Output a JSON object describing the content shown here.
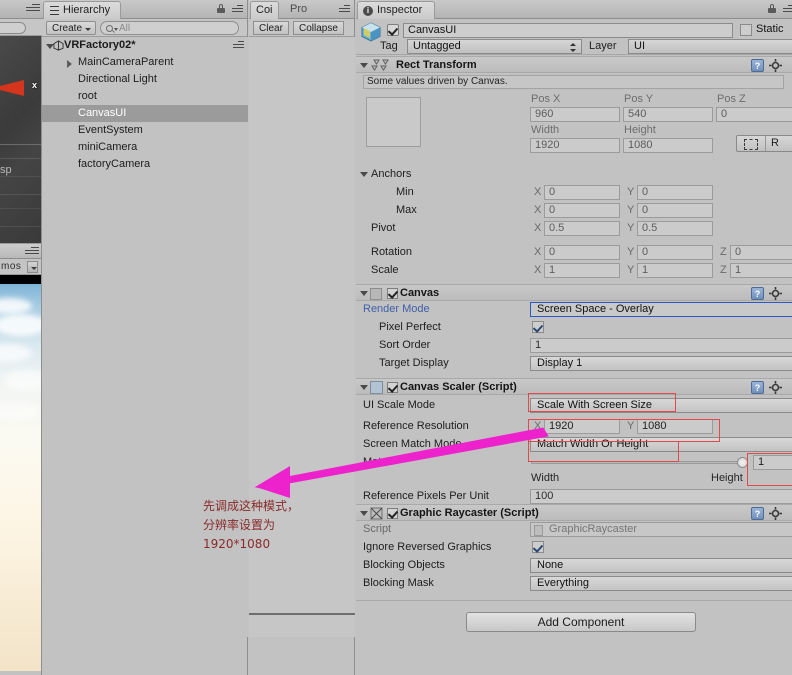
{
  "scene_view": {
    "gizmo_axis_label": "x",
    "partial_text": "sp",
    "gizmos_label": "mos"
  },
  "hierarchy": {
    "tab_label": "Hierarchy",
    "create_label": "Create",
    "search_placeholder": "All",
    "root": {
      "label": "VRFactory02*"
    },
    "items": [
      {
        "label": "MainCameraParent",
        "has_children": true,
        "selected": false
      },
      {
        "label": "Directional Light",
        "has_children": false,
        "selected": false
      },
      {
        "label": "root",
        "has_children": false,
        "selected": false
      },
      {
        "label": "CanvasUI",
        "has_children": false,
        "selected": true
      },
      {
        "label": "EventSystem",
        "has_children": false,
        "selected": false
      },
      {
        "label": "miniCamera",
        "has_children": false,
        "selected": false
      },
      {
        "label": "factoryCamera",
        "has_children": false,
        "selected": false
      }
    ]
  },
  "console": {
    "tab_active": "Coi",
    "tab_inactive": "Pro",
    "clear_label": "Clear",
    "collapse_label": "Collapse"
  },
  "inspector": {
    "tab_label": "Inspector",
    "object_name": "CanvasUI",
    "static_label": "Static",
    "tag_label": "Tag",
    "tag_value": "Untagged",
    "layer_label": "Layer",
    "layer_value": "UI",
    "add_component_label": "Add Component",
    "components": [
      {
        "title": "Rect Transform",
        "driven_note": "Some values driven by Canvas.",
        "pos_headers": [
          "Pos X",
          "Pos Y",
          "Pos Z"
        ],
        "pos_values": [
          "960",
          "540",
          "0"
        ],
        "size_headers": [
          "Width",
          "Height"
        ],
        "size_values": [
          "1920",
          "1080"
        ],
        "rect_tool_label": "R",
        "anchors_label": "Anchors",
        "min_label": "Min",
        "min_x": "0",
        "min_y": "0",
        "max_label": "Max",
        "max_x": "0",
        "max_y": "0",
        "pivot_label": "Pivot",
        "pivot_x": "0.5",
        "pivot_y": "0.5",
        "rotation_label": "Rotation",
        "rot_x": "0",
        "rot_y": "0",
        "rot_z": "0",
        "scale_label": "Scale",
        "scale_x": "1",
        "scale_y": "1",
        "scale_z": "1",
        "axis_x": "X",
        "axis_y": "Y",
        "axis_z": "Z"
      },
      {
        "title": "Canvas",
        "render_mode_label": "Render Mode",
        "render_mode_value": "Screen Space - Overlay",
        "pixel_perfect_label": "Pixel Perfect",
        "sort_order_label": "Sort Order",
        "sort_order_value": "1",
        "target_display_label": "Target Display",
        "target_display_value": "Display 1"
      },
      {
        "title": "Canvas Scaler (Script)",
        "ui_scale_mode_label": "UI Scale Mode",
        "ui_scale_mode_value": "Scale With Screen Size",
        "ref_res_label": "Reference Resolution",
        "ref_res_x": "1920",
        "ref_res_y": "1080",
        "screen_match_label": "Screen Match Mode",
        "screen_match_value": "Match Width Or Height",
        "match_label": "Match",
        "match_value": "1",
        "width_label": "Width",
        "height_label": "Height",
        "ref_ppu_label": "Reference Pixels Per Unit",
        "ref_ppu_value": "100"
      },
      {
        "title": "Graphic Raycaster (Script)",
        "script_label": "Script",
        "script_value": "GraphicRaycaster",
        "ignore_reversed_label": "Ignore Reversed Graphics",
        "blocking_objects_label": "Blocking Objects",
        "blocking_objects_value": "None",
        "blocking_mask_label": "Blocking Mask",
        "blocking_mask_value": "Everything"
      }
    ]
  },
  "annotation": {
    "lines": [
      "先调成这种模式，",
      "分辨率设置为",
      "1920*1080"
    ],
    "arrow_color": "#ee22cc",
    "highlight_color": "#e04a4a",
    "text_color": "#8a2a2a"
  }
}
